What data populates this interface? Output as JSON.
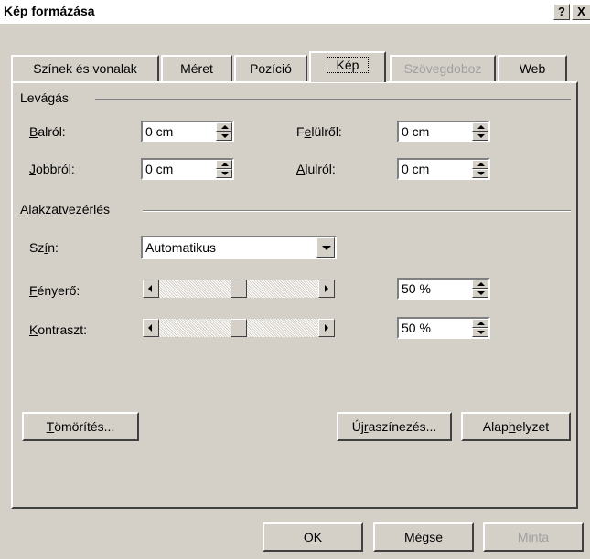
{
  "window": {
    "title": "Kép formázása",
    "help_label": "?",
    "close_label": "X"
  },
  "tabs": [
    {
      "label": "Színek és vonalak",
      "state": "normal"
    },
    {
      "label": "Méret",
      "state": "normal"
    },
    {
      "label": "Pozíció",
      "state": "normal"
    },
    {
      "label": "Kép",
      "state": "active"
    },
    {
      "label": "Szövegdoboz",
      "state": "disabled"
    },
    {
      "label": "Web",
      "state": "normal"
    }
  ],
  "cropping": {
    "group_label": "Levágás",
    "left": {
      "label_u": "B",
      "label_rest": "alról:",
      "value": "0 cm"
    },
    "top": {
      "label_pre": "F",
      "label_u": "e",
      "label_rest": "lülről:",
      "value": "0 cm"
    },
    "right": {
      "label_u": "J",
      "label_rest": "obbról:",
      "value": "0 cm"
    },
    "bottom": {
      "label_u": "A",
      "label_rest": "lulról:",
      "value": "0 cm"
    }
  },
  "image_control": {
    "group_label": "Alakzatvezérlés",
    "color": {
      "label_pre": "Sz",
      "label_u": "í",
      "label_rest": "n:",
      "value": "Automatikus"
    },
    "brightness": {
      "label_u": "F",
      "label_rest": "ényerő:",
      "value": "50 %",
      "level_percent": 50
    },
    "contrast": {
      "label_u": "K",
      "label_rest": "ontraszt:",
      "value": "50 %",
      "level_percent": 50
    }
  },
  "buttons": {
    "compress": {
      "label_u": "T",
      "label_rest": "ömörítés..."
    },
    "recolor": {
      "label_pre": "Új",
      "label_u": "r",
      "label_rest": "aszínezés..."
    },
    "reset": {
      "label_pre": "Alap",
      "label_u": "h",
      "label_rest": "elyzet"
    },
    "ok": "OK",
    "cancel": "Mégse",
    "preview": "Minta"
  }
}
